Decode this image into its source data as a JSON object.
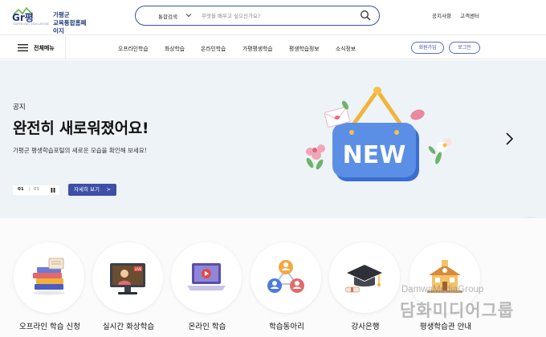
{
  "header": {
    "logo_brand": "Gr평",
    "logo_line1": "가평군",
    "logo_line2": "교육통합홈페이지",
    "logo_sub": "GAPYEONG EDUCATION",
    "search_category": "통합검색",
    "search_placeholder": "무엇을 배우고 싶으신가요?",
    "notice": "공지사항",
    "help": "고객센터"
  },
  "nav": {
    "all_menu": "전체메뉴",
    "items": [
      "오프라인학습",
      "화상학습",
      "온라인학습",
      "가평평생학습",
      "평생학습정보",
      "소식정보"
    ],
    "join": "회원가입",
    "login": "로그인"
  },
  "hero": {
    "kicker": "공지",
    "title": "완전히 새로워졌어요!",
    "description": "가평군 평생학습포털의 새로운 모습을 확인해 보세요!",
    "page_current": "01",
    "page_sep": "|",
    "page_total": "01",
    "detail_button": "자세히 보기",
    "detail_arrow": ">",
    "sign_text": "NEW"
  },
  "quick_menu": [
    {
      "label": "오프라인 학습 신청",
      "icon": "books-stack-icon"
    },
    {
      "label": "실시간 화상학습",
      "icon": "live-class-icon"
    },
    {
      "label": "온라인 학습",
      "icon": "laptop-video-icon"
    },
    {
      "label": "학습동아리",
      "icon": "network-people-icon"
    },
    {
      "label": "강사은행",
      "icon": "graduation-cap-icon"
    },
    {
      "label": "평생학습관 안내",
      "icon": "school-building-icon"
    }
  ],
  "watermark": {
    "en": "DamwaMediaGroup",
    "ko": "담화미디어그룹"
  },
  "colors": {
    "primary": "#3d4fa6",
    "hero_bg": "#eef3f8",
    "sign_blue": "#5b8fe6"
  }
}
